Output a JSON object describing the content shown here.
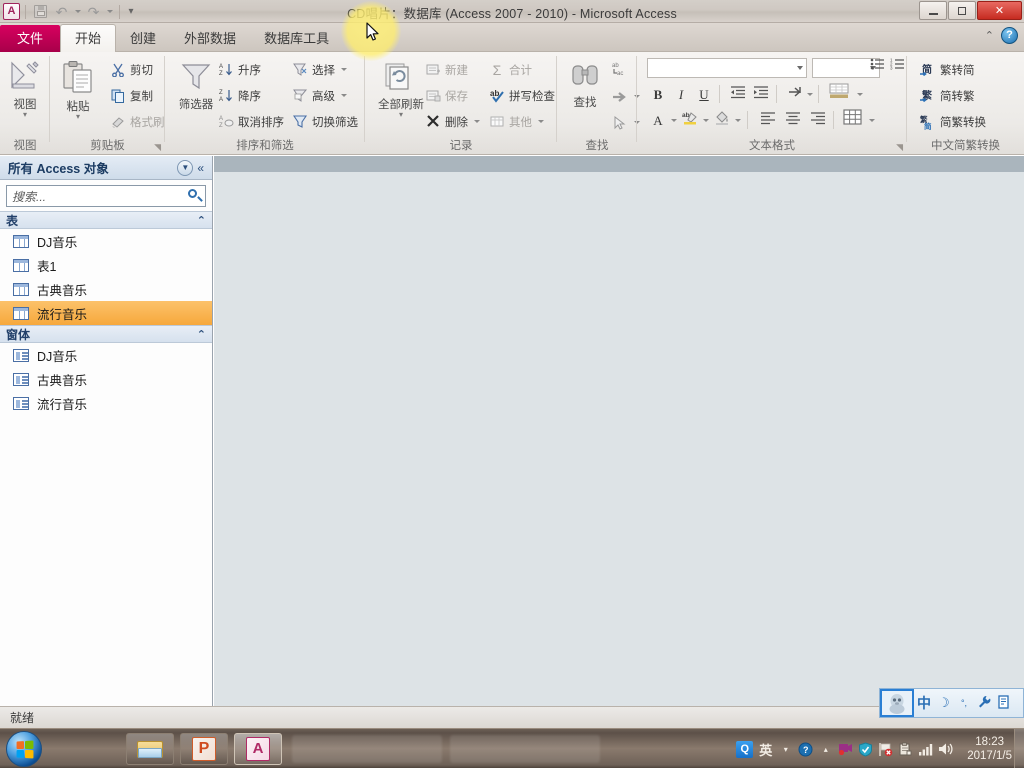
{
  "window": {
    "title": "CD唱片：数据库 (Access 2007 - 2010)  -  Microsoft Access",
    "app_logo": "A",
    "controls": {
      "minimize": "minimize-icon",
      "restore": "restore-icon",
      "close": "✕"
    }
  },
  "quick_access": {
    "items": [
      {
        "name": "save-button",
        "icon": "save-icon",
        "label": "保存"
      },
      {
        "name": "undo-button",
        "icon": "undo-icon",
        "label": "撤消"
      },
      {
        "name": "redo-button",
        "icon": "redo-icon",
        "label": "恢复"
      },
      {
        "name": "customize-qat-button",
        "icon": "chevron-down-icon",
        "label": "自定义快速访问工具栏"
      }
    ]
  },
  "ribbon": {
    "file_tab": "文件",
    "tabs": [
      {
        "label": "开始",
        "active": true
      },
      {
        "label": "创建",
        "active": false
      },
      {
        "label": "外部数据",
        "active": false
      },
      {
        "label": "数据库工具",
        "active": false
      }
    ],
    "collapse_icon": "⌃",
    "help_icon": "?",
    "groups": [
      {
        "title": "视图",
        "big": [
          {
            "label": "视图",
            "icon": "view-icon"
          }
        ],
        "small": []
      },
      {
        "title": "剪贴板",
        "big": [
          {
            "label": "粘贴",
            "icon": "paste-icon"
          }
        ],
        "small": [
          {
            "label": "剪切",
            "icon": "cut-icon",
            "dim": false
          },
          {
            "label": "复制",
            "icon": "copy-icon",
            "dim": false
          },
          {
            "label": "格式刷",
            "icon": "format-painter-icon",
            "dim": true
          }
        ]
      },
      {
        "title": "排序和筛选",
        "big": [
          {
            "label": "筛选器",
            "icon": "filter-icon"
          }
        ],
        "small": [
          {
            "label": "升序",
            "icon": "sort-ascending-icon",
            "dim": false
          },
          {
            "label": "降序",
            "icon": "sort-descending-icon",
            "dim": false
          },
          {
            "label": "取消排序",
            "icon": "clear-sort-icon",
            "dim": false
          },
          {
            "label": "选择",
            "icon": "selection-icon",
            "dim": false
          },
          {
            "label": "高级",
            "icon": "advanced-filter-icon",
            "dim": false
          },
          {
            "label": "切换筛选",
            "icon": "toggle-filter-icon",
            "dim": false
          }
        ]
      },
      {
        "title": "记录",
        "big": [
          {
            "label": "全部刷新",
            "icon": "refresh-all-icon"
          }
        ],
        "small": [
          {
            "label": "新建",
            "icon": "new-record-icon",
            "dim": true
          },
          {
            "label": "保存",
            "icon": "save-record-icon",
            "dim": true
          },
          {
            "label": "删除",
            "icon": "delete-record-icon",
            "dim": false
          },
          {
            "label": "合计",
            "icon": "totals-icon",
            "dim": true
          },
          {
            "label": "拼写检查",
            "icon": "spelling-icon",
            "dim": false
          },
          {
            "label": "其他",
            "icon": "more-icon",
            "dim": true
          }
        ]
      },
      {
        "title": "查找",
        "big": [
          {
            "label": "查找",
            "icon": "find-binoculars-icon"
          }
        ],
        "small": [
          {
            "label": "",
            "icon": "replace-icon",
            "dim": true
          },
          {
            "label": "",
            "icon": "goto-arrow-icon",
            "dim": true
          },
          {
            "label": "",
            "icon": "select-pointer-icon",
            "dim": true
          }
        ]
      },
      {
        "title": "文本格式",
        "font_name": "",
        "font_size": "",
        "buttons": [
          "B",
          "I",
          "U",
          "A"
        ]
      },
      {
        "title": "中文简繁转换",
        "small": [
          {
            "label": "繁转简",
            "icon": "trad-to-simp-icon",
            "dim": false
          },
          {
            "label": "简转繁",
            "icon": "simp-to-trad-icon",
            "dim": false
          },
          {
            "label": "简繁转换",
            "icon": "simp-trad-convert-icon",
            "dim": false
          }
        ]
      }
    ]
  },
  "nav_pane": {
    "header": "所有 Access 对象",
    "menu_icon": "chevron-down-icon",
    "collapse_icon": "«",
    "search": {
      "placeholder": "搜索...",
      "value": "",
      "icon": "search-icon"
    },
    "groups": [
      {
        "name": "表",
        "collapse_icon": "⌃",
        "items": [
          {
            "label": "DJ音乐",
            "icon": "table-icon",
            "selected": false
          },
          {
            "label": "表1",
            "icon": "table-icon",
            "selected": false
          },
          {
            "label": "古典音乐",
            "icon": "table-icon",
            "selected": false
          },
          {
            "label": "流行音乐",
            "icon": "table-icon",
            "selected": true
          }
        ]
      },
      {
        "name": "窗体",
        "collapse_icon": "⌃",
        "items": [
          {
            "label": "DJ音乐",
            "icon": "form-icon",
            "selected": false
          },
          {
            "label": "古典音乐",
            "icon": "form-icon",
            "selected": false
          },
          {
            "label": "流行音乐",
            "icon": "form-icon",
            "selected": false
          }
        ]
      }
    ]
  },
  "status_bar": {
    "text": "就绪"
  },
  "ime_bar": {
    "items": [
      {
        "name": "qq-pinyin-icon",
        "glyph": "🐧"
      },
      {
        "name": "ime-mode-chinese",
        "glyph": "中"
      },
      {
        "name": "ime-halfwidth-icon",
        "glyph": "☽"
      },
      {
        "name": "ime-punctuation-icon",
        "glyph": "°,"
      },
      {
        "name": "ime-settings-icon",
        "glyph": "🔧"
      },
      {
        "name": "ime-toolbox-icon",
        "glyph": "🗄"
      }
    ]
  },
  "taskbar": {
    "start_label": "开始",
    "buttons": [
      {
        "name": "taskbar-explorer",
        "icon": "folder-icon",
        "label": "Windows 资源管理器",
        "active": false
      },
      {
        "name": "taskbar-powerpoint",
        "icon": "powerpoint-icon",
        "label": "P",
        "active": false
      },
      {
        "name": "taskbar-access",
        "icon": "access-icon",
        "label": "A",
        "active": true
      }
    ],
    "tray": [
      {
        "name": "qq-tray-icon",
        "glyph": "Q"
      },
      {
        "name": "ime-language-icon",
        "glyph": "英"
      },
      {
        "name": "tray-chevron-icon",
        "glyph": "▾"
      },
      {
        "name": "action-center-icon",
        "glyph": "?"
      },
      {
        "name": "tray-expand-icon",
        "glyph": "▴"
      },
      {
        "name": "recorder-icon",
        "glyph": "🎬"
      },
      {
        "name": "security-shield-icon",
        "glyph": "🛡"
      },
      {
        "name": "network-flag-icon",
        "glyph": "⚑"
      },
      {
        "name": "clipboard-icon",
        "glyph": "📋"
      },
      {
        "name": "signal-bars-icon",
        "glyph": "▂▄▆"
      },
      {
        "name": "volume-icon",
        "glyph": "🔊"
      }
    ],
    "clock": {
      "time": "18:23",
      "date": "2017/1/5"
    }
  },
  "colors": {
    "file_tab": "#d8005f",
    "selection": "#f6a83c",
    "nav_header": "#cfdcea",
    "workarea": "#dde3e6"
  }
}
